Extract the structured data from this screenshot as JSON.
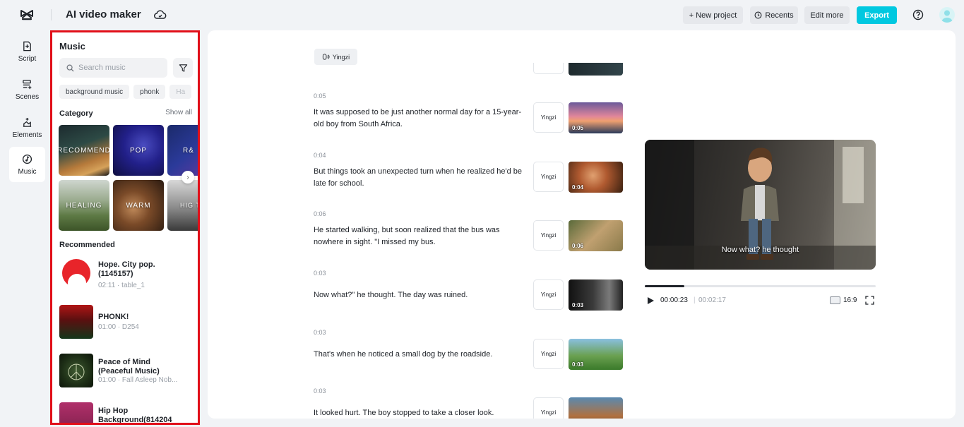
{
  "header": {
    "app_title": "AI video maker",
    "new_project_label": "+ New project",
    "recents_label": "Recents",
    "edit_more_label": "Edit more",
    "export_label": "Export"
  },
  "rail": {
    "items": [
      {
        "label": "Script",
        "icon": "script-icon"
      },
      {
        "label": "Scenes",
        "icon": "scenes-icon"
      },
      {
        "label": "Elements",
        "icon": "elements-icon"
      },
      {
        "label": "Music",
        "icon": "music-icon",
        "active": true
      }
    ]
  },
  "music_panel": {
    "title": "Music",
    "search_placeholder": "Search music",
    "chips": [
      "background music",
      "phonk",
      "Ha"
    ],
    "category_label": "Category",
    "show_all_label": "Show all",
    "categories": [
      "RECOMMEND",
      "POP",
      "R&",
      "HEALING",
      "WARM",
      "HIG TEM"
    ],
    "recommended_label": "Recommended",
    "tracks": [
      {
        "title": "Hope. City pop. (1145157)",
        "meta": "02:11 · table_1"
      },
      {
        "title": "PHONK!",
        "meta": "01:00 · D254"
      },
      {
        "title": "Peace of Mind (Peaceful Music)",
        "meta": "01:00 · Fall Asleep Nob..."
      },
      {
        "title": "Hip Hop Background(814204",
        "meta": ""
      }
    ]
  },
  "script": {
    "voice_label": "Yingzi",
    "scenes": [
      {
        "duration": "0:05",
        "text": "It was supposed to be just another normal day for a 15-year-old boy from South Africa.",
        "voice": "Yingzi",
        "thumb_time": "0:05"
      },
      {
        "duration": "0:04",
        "text": "But things took an unexpected turn when he realized he'd be late for school.",
        "voice": "Yingzi",
        "thumb_time": "0:04"
      },
      {
        "duration": "0:06",
        "text": "He started walking, but soon realized that the bus was nowhere in sight. \"I missed my bus.",
        "voice": "Yingzi",
        "thumb_time": "0:06"
      },
      {
        "duration": "0:03",
        "text": "Now what?\" he thought. The day was ruined.",
        "voice": "Yingzi",
        "thumb_time": "0:03"
      },
      {
        "duration": "0:03",
        "text": "That's when he noticed a small dog by the roadside.",
        "voice": "Yingzi",
        "thumb_time": "0:03"
      },
      {
        "duration": "0:03",
        "text": "It looked hurt. The boy stopped to take a closer look.",
        "voice": "Yingzi",
        "thumb_time": ""
      }
    ]
  },
  "preview": {
    "caption": "Now what?  he thought",
    "current_time": "00:00:23",
    "separator": "|",
    "total_time": "00:02:17",
    "progress_fraction": 0.17,
    "aspect_ratio": "16:9"
  },
  "colors": {
    "accent": "#00c8e0",
    "panel_highlight": "#e10f19"
  }
}
